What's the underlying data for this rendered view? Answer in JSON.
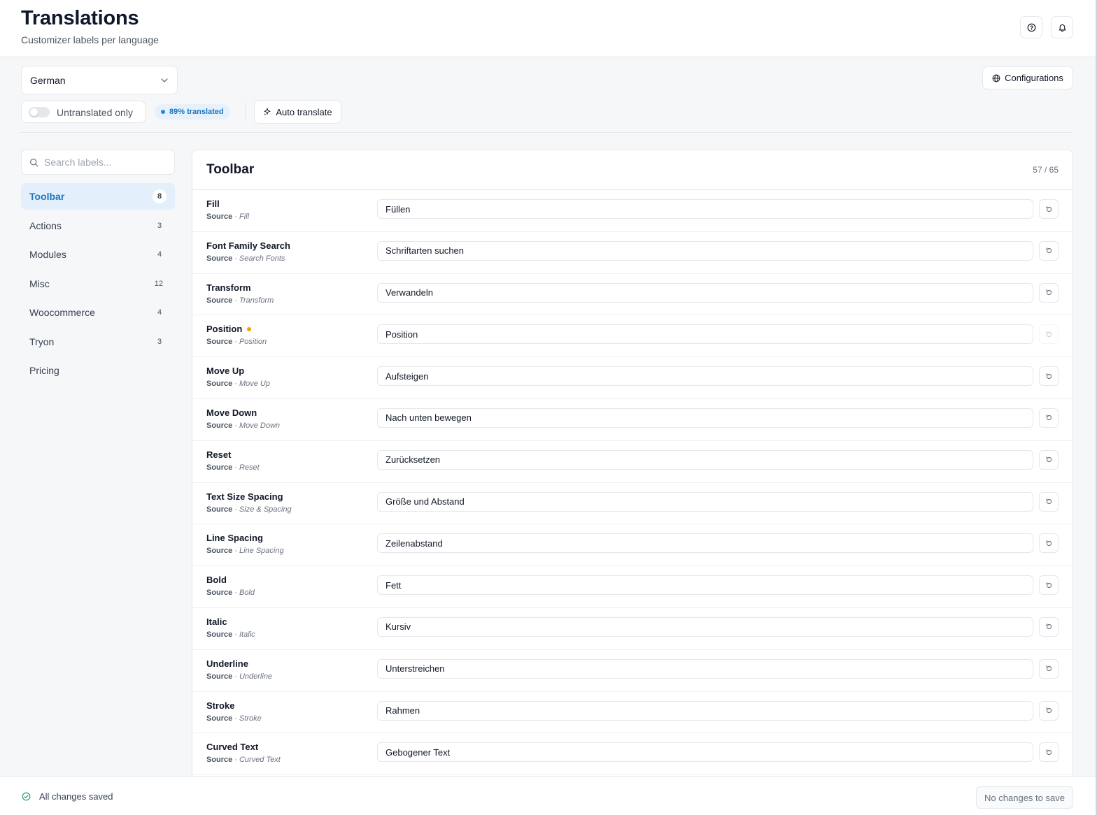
{
  "header": {
    "title": "Translations",
    "subtitle": "Customizer labels per language",
    "help_icon": "help-circle-icon",
    "bell_icon": "bell-icon"
  },
  "controls": {
    "language": "German",
    "configurations_label": "Configurations",
    "untranslated_label": "Untranslated only",
    "untranslated_enabled": false,
    "translated_badge": "89% translated",
    "auto_translate_label": "Auto translate"
  },
  "search": {
    "placeholder": "Search labels..."
  },
  "sidebar": {
    "items": [
      {
        "label": "Toolbar",
        "count": "8",
        "active": true
      },
      {
        "label": "Actions",
        "count": "3",
        "active": false
      },
      {
        "label": "Modules",
        "count": "4",
        "active": false
      },
      {
        "label": "Misc",
        "count": "12",
        "active": false
      },
      {
        "label": "Woocommerce",
        "count": "4",
        "active": false
      },
      {
        "label": "Tryon",
        "count": "3",
        "active": false
      },
      {
        "label": "Pricing",
        "count": "",
        "active": false
      }
    ]
  },
  "panel": {
    "title": "Toolbar",
    "count": "57 / 65",
    "source_label": "Source",
    "source_sep": "·",
    "rows": [
      {
        "key": "Fill",
        "source": "Fill",
        "value": "Füllen",
        "pending": false
      },
      {
        "key": "Font Family Search",
        "source": "Search Fonts",
        "value": "Schriftarten suchen",
        "pending": false
      },
      {
        "key": "Transform",
        "source": "Transform",
        "value": "Verwandeln",
        "pending": false
      },
      {
        "key": "Position",
        "source": "Position",
        "value": "Position",
        "pending": true
      },
      {
        "key": "Move Up",
        "source": "Move Up",
        "value": "Aufsteigen",
        "pending": false
      },
      {
        "key": "Move Down",
        "source": "Move Down",
        "value": "Nach unten bewegen",
        "pending": false
      },
      {
        "key": "Reset",
        "source": "Reset",
        "value": "Zurücksetzen",
        "pending": false
      },
      {
        "key": "Text Size Spacing",
        "source": "Size & Spacing",
        "value": "Größe und Abstand",
        "pending": false
      },
      {
        "key": "Line Spacing",
        "source": "Line Spacing",
        "value": "Zeilenabstand",
        "pending": false
      },
      {
        "key": "Bold",
        "source": "Bold",
        "value": "Fett",
        "pending": false
      },
      {
        "key": "Italic",
        "source": "Italic",
        "value": "Kursiv",
        "pending": false
      },
      {
        "key": "Underline",
        "source": "Underline",
        "value": "Unterstreichen",
        "pending": false
      },
      {
        "key": "Stroke",
        "source": "Stroke",
        "value": "Rahmen",
        "pending": false
      },
      {
        "key": "Curved Text",
        "source": "Curved Text",
        "value": "Gebogener Text",
        "pending": false
      }
    ]
  },
  "footer": {
    "status": "All changes saved",
    "save_label": "No changes to save"
  },
  "colors": {
    "accent": "#1d75c2",
    "pending": "#f59e0b",
    "success": "#22a06b"
  }
}
